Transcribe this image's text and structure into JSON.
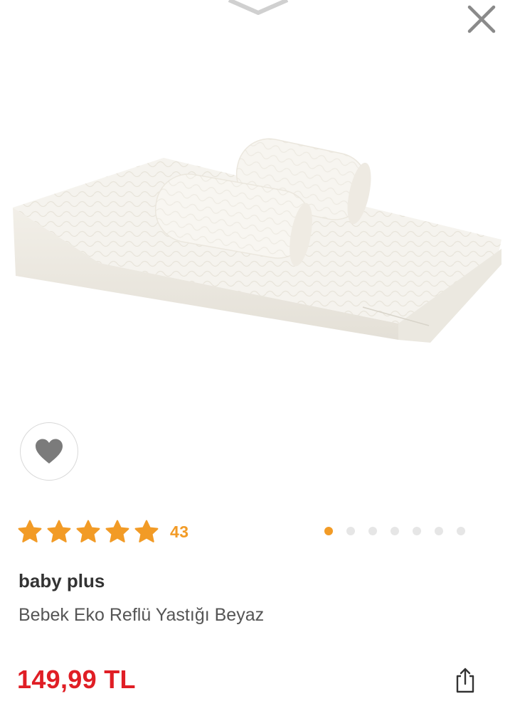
{
  "header": {
    "chevron_icon": "chevron-up-icon",
    "close_icon": "close-icon"
  },
  "product": {
    "image_alt": "product-image",
    "favorite_icon": "heart-icon",
    "rating": {
      "stars": 5,
      "max": 5,
      "count": "43"
    },
    "gallery": {
      "total": 7,
      "active": 1
    },
    "brand": "baby plus",
    "title": "Bebek Eko Reflü Yastığı Beyaz",
    "price": "149,99 TL",
    "share_icon": "share-icon"
  },
  "colors": {
    "star": "#f29b26",
    "price": "#e01e25",
    "dot_active": "#f29b26",
    "dot_inactive": "#e6e6e6"
  }
}
